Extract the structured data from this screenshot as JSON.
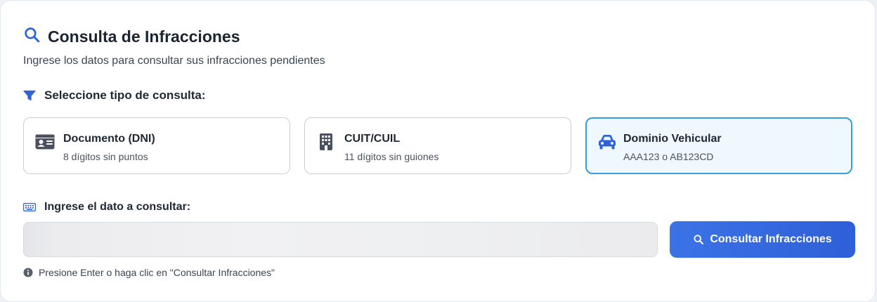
{
  "header": {
    "title": "Consulta de Infracciones",
    "subtitle": "Ingrese los datos para consultar sus infracciones pendientes",
    "icon": "search-icon"
  },
  "query_type": {
    "label": "Seleccione tipo de consulta:",
    "icon": "filter-icon",
    "options": [
      {
        "title": "Documento (DNI)",
        "description": "8 dígitos sin puntos",
        "icon": "id-card-icon",
        "selected": false
      },
      {
        "title": "CUIT/CUIL",
        "description": "11 dígitos sin guiones",
        "icon": "building-icon",
        "selected": false
      },
      {
        "title": "Dominio Vehicular",
        "description": "AAA123 o AB123CD",
        "icon": "car-icon",
        "selected": true
      }
    ]
  },
  "input_section": {
    "label": "Ingrese el dato a consultar:",
    "icon": "keyboard-icon",
    "value": "",
    "submit_label": "Consultar Infracciones",
    "hint": "Presione Enter o haga clic en \"Consultar Infracciones\"",
    "hint_icon": "info-icon"
  },
  "colors": {
    "accent": "#3066DE",
    "selected_border": "#3A9BD7",
    "selected_background": "#EEF8FD",
    "icon_gray": "#4A5060"
  }
}
